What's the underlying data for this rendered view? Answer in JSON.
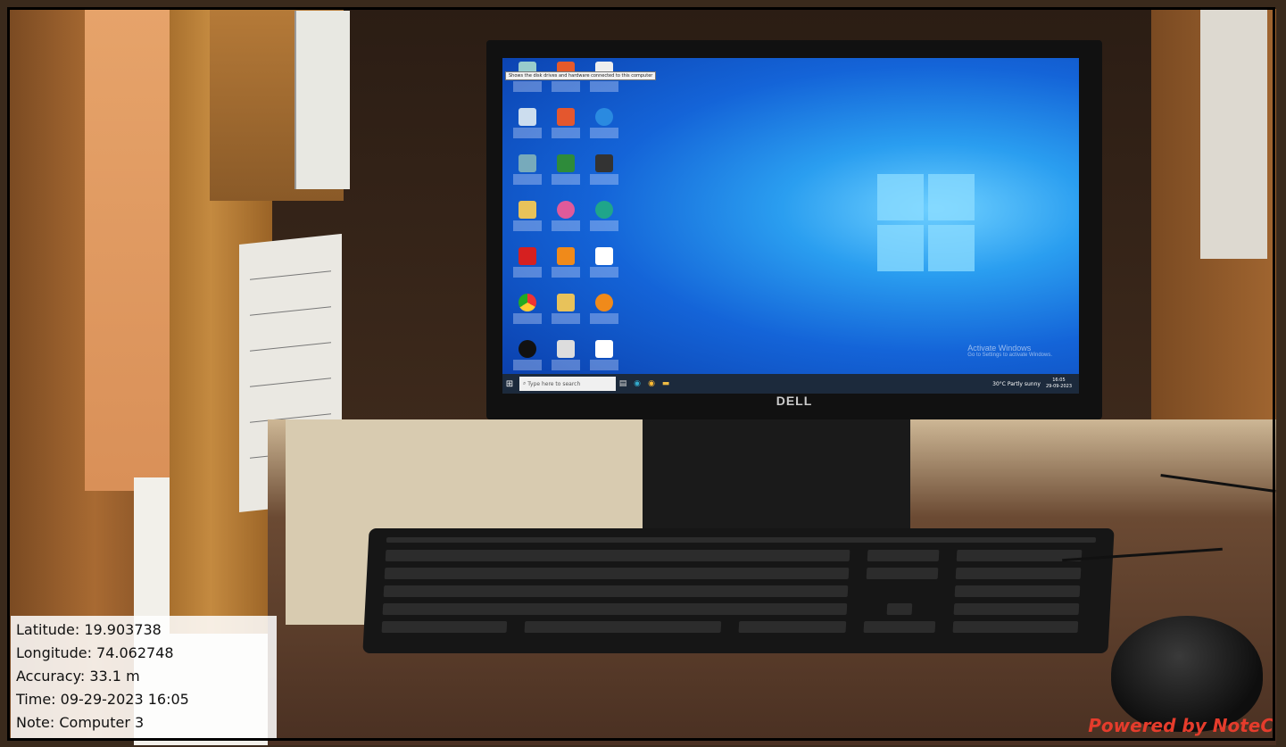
{
  "photo_overlay": {
    "latitude": "Latitude: 19.903738",
    "longitude": "Longitude: 74.062748",
    "accuracy": "Accuracy: 33.1 m",
    "time": "Time: 09-29-2023 16:05",
    "note": "Note: Computer 3",
    "branding": "Powered by NoteC"
  },
  "monitor": {
    "brand": "DELL",
    "tooltip": "Shows the disk drives and hardware connected to this computer",
    "watermark_title": "Activate Windows",
    "watermark_subtitle": "Go to Settings to activate Windows.",
    "search_placeholder": "Type here to search",
    "weather": "30°C  Partly sunny",
    "clock_time": "16:05",
    "clock_date": "29-09-2023"
  },
  "colors": {
    "desktop_blue": "#1464d8",
    "taskbar": "#1c2a3c",
    "branding_red": "#e53c2c"
  }
}
